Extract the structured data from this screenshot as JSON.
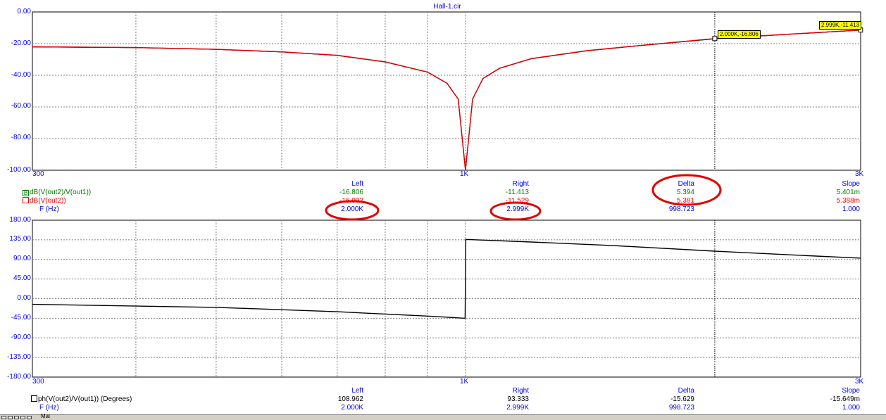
{
  "window": {
    "title": "Hall-1.cir"
  },
  "colors": {
    "axis_text": "#0000ff",
    "magnitude_curve": "#e00000",
    "phase_curve": "#000000",
    "trace1_text": "#008000",
    "trace2_text": "#ff0000",
    "highlight": "#e00000",
    "marker_label_bg": "#ffff00"
  },
  "top_plot": {
    "y_ticks": [
      "0.00",
      "-20.00",
      "-40.00",
      "-60.00",
      "-80.00",
      "-100.00"
    ],
    "x_ticks": [
      "300",
      "1K",
      "3K"
    ]
  },
  "bottom_plot": {
    "y_ticks": [
      "180.00",
      "135.00",
      "90.00",
      "45.00",
      "0.00",
      "-45.00",
      "-90.00",
      "-135.00",
      "-180.00"
    ],
    "x_ticks": [
      "300",
      "1K",
      "3K"
    ]
  },
  "markers": {
    "left_label": "2.000K,-16.806",
    "right_label": "2.999K,-11.413"
  },
  "top_readout": {
    "headers": [
      "Left",
      "Right",
      "Delta",
      "Slope"
    ],
    "rows": [
      {
        "name": "dB(V(out2)/V(out1))",
        "check": "B",
        "values": [
          "-16.806",
          "-11.413",
          "5.394",
          "5.401m"
        ]
      },
      {
        "name": "dB(V(out2))",
        "check": "",
        "values": [
          "-16.992",
          "-11.529",
          "5.381",
          "5.388m"
        ]
      },
      {
        "name": "F (Hz)",
        "check": "",
        "values": [
          "2.000K",
          "2.999K",
          "998.723",
          "1.000"
        ]
      }
    ]
  },
  "bottom_readout": {
    "headers": [
      "Left",
      "Right",
      "Delta",
      "Slope"
    ],
    "rows": [
      {
        "name": "ph(V(out2)/V(out1)) (Degrees)",
        "check": "",
        "values": [
          "108.962",
          "93.333",
          "-15.629",
          "-15.649m"
        ]
      },
      {
        "name": "F (Hz)",
        "check": "",
        "values": [
          "2.000K",
          "2.999K",
          "998.723",
          "1.000"
        ]
      }
    ]
  },
  "status_bar": {
    "tab_label": "Mai"
  },
  "chart_data": [
    {
      "type": "line",
      "x_scale": "log",
      "xlim": [
        300,
        3000
      ],
      "ylim": [
        -100,
        0
      ],
      "grid": true,
      "series": [
        {
          "name": "dB(V(out2)/V(out1))",
          "x": [
            300,
            400,
            500,
            600,
            700,
            800,
            900,
            950,
            980,
            1000,
            1020,
            1050,
            1100,
            1200,
            1400,
            1600,
            2000,
            2500,
            3000
          ],
          "y": [
            -22.0,
            -22.5,
            -23.6,
            -25.2,
            -27.4,
            -31.5,
            -38.0,
            -45.0,
            -55.0,
            -100.0,
            -55.0,
            -42.0,
            -35.5,
            -29.5,
            -24.5,
            -21.5,
            -16.8,
            -13.8,
            -11.4
          ]
        },
        {
          "name": "dB(V(out2))",
          "x": [
            300,
            400,
            500,
            600,
            700,
            800,
            900,
            950,
            980,
            1000,
            1020,
            1050,
            1100,
            1200,
            1400,
            1600,
            2000,
            2500,
            3000
          ],
          "y": [
            -22.1,
            -22.6,
            -23.7,
            -25.3,
            -27.5,
            -31.6,
            -38.1,
            -45.1,
            -55.1,
            -100.0,
            -55.1,
            -42.1,
            -35.6,
            -29.6,
            -24.6,
            -21.6,
            -16.99,
            -13.9,
            -11.53
          ]
        }
      ]
    },
    {
      "type": "line",
      "x_scale": "log",
      "xlim": [
        300,
        3000
      ],
      "ylim": [
        -180,
        180
      ],
      "grid": true,
      "series": [
        {
          "name": "ph(V(out2)/V(out1))",
          "x": [
            300,
            500,
            700,
            900,
            999,
            1001,
            1200,
            1500,
            2000,
            2500,
            3000
          ],
          "y": [
            -13,
            -20,
            -30,
            -40,
            -45,
            136,
            130,
            122,
            109,
            100,
            93
          ]
        }
      ]
    }
  ]
}
